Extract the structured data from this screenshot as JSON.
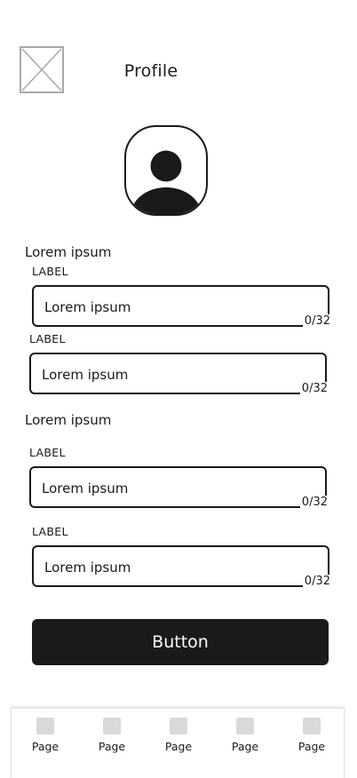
{
  "header": {
    "image_icon": "image-placeholder-icon",
    "title": "Profile"
  },
  "avatar": {
    "icon": "user-avatar-icon"
  },
  "sections": [
    {
      "heading": "Lorem ipsum",
      "fields": [
        {
          "label": "LABEL",
          "value": "Lorem ipsum",
          "counter": "0/32"
        },
        {
          "label": "LABEL",
          "value": "Lorem ipsum",
          "counter": "0/32"
        }
      ]
    },
    {
      "heading": "Lorem ipsum",
      "fields": [
        {
          "label": "LABEL",
          "value": "Lorem ipsum",
          "counter": "0/32"
        },
        {
          "label": "LABEL",
          "value": "Lorem ipsum",
          "counter": "0/32"
        }
      ]
    }
  ],
  "button": {
    "label": "Button"
  },
  "tab_bar": {
    "items": [
      {
        "label": "Page",
        "icon": "page-icon"
      },
      {
        "label": "Page",
        "icon": "page-icon"
      },
      {
        "label": "Page",
        "icon": "page-icon"
      },
      {
        "label": "Page",
        "icon": "page-icon"
      },
      {
        "label": "Page",
        "icon": "page-icon"
      }
    ]
  },
  "colors": {
    "primary": "#1a1a1a",
    "placeholder_border": "#a9a9a9",
    "tab_icon": "#d9d9d9"
  }
}
